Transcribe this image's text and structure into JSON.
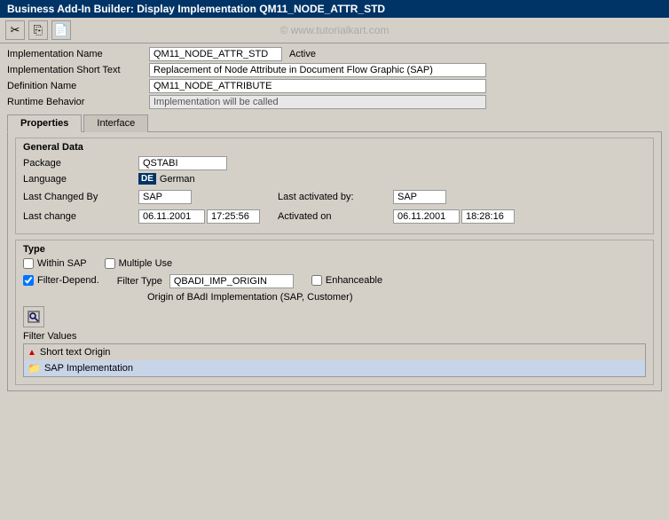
{
  "titleBar": {
    "text": "Business Add-In Builder: Display Implementation QM11_NODE_ATTR_STD"
  },
  "toolbar": {
    "watermark": "© www.tutorialkart.com",
    "buttons": [
      "✂",
      "📋",
      "🖃"
    ]
  },
  "fields": {
    "implementationNameLabel": "Implementation Name",
    "implementationNameValue": "QM11_NODE_ATTR_STD",
    "statusValue": "Active",
    "implementationShortTextLabel": "Implementation Short Text",
    "implementationShortTextValue": "Replacement of Node Attribute in Document Flow Graphic (SAP)",
    "definitionNameLabel": "Definition Name",
    "definitionNameValue": "QM11_NODE_ATTRIBUTE",
    "runtimeBehaviorLabel": "Runtime Behavior",
    "runtimeBehaviorValue": "Implementation will be called"
  },
  "tabs": [
    {
      "label": "Properties",
      "active": true
    },
    {
      "label": "Interface",
      "active": false
    }
  ],
  "generalData": {
    "title": "General Data",
    "packageLabel": "Package",
    "packageValue": "QSTABI",
    "languageLabel": "Language",
    "languageCode": "DE",
    "languageName": "German",
    "lastChangedByLabel": "Last Changed By",
    "lastChangedByValue": "SAP",
    "lastActivatedByLabel": "Last activated by:",
    "lastActivatedByValue": "SAP",
    "lastChangeLabel": "Last change",
    "lastChangeDate": "06.11.2001",
    "lastChangeTime": "17:25:56",
    "activatedOnLabel": "Activated on",
    "activatedOnDate": "06.11.2001",
    "activatedOnTime": "18:28:16"
  },
  "typeSection": {
    "title": "Type",
    "withinSAPLabel": "Within SAP",
    "withinSAPChecked": false,
    "multipleUseLabel": "Multiple Use",
    "multipleUseChecked": false,
    "filterDependLabel": "Filter-Depend.",
    "filterDependChecked": true,
    "filterTypeLabel": "Filter Type",
    "filterTypeValue": "QBADI_IMP_ORIGIN",
    "enhanceableLabel": "Enhanceable",
    "enhanceableChecked": false,
    "filterDesc": "Origin of BAdI Implementation (SAP, Customer)",
    "filterValuesLabel": "Filter Values",
    "filterRows": [
      {
        "icon": "up",
        "text": "Short text Origin",
        "selected": false
      },
      {
        "icon": "folder",
        "text": "SAP Implementation",
        "selected": true
      }
    ]
  }
}
